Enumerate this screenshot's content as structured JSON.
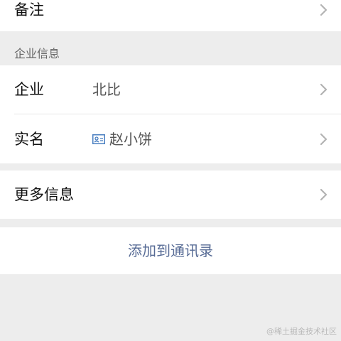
{
  "remark_row": {
    "label": "备注"
  },
  "enterprise_section": {
    "title": "企业信息"
  },
  "enterprise_row": {
    "label": "企业",
    "value": "北比"
  },
  "realname_row": {
    "label": "实名",
    "value": "赵小饼",
    "icon": "id-card-icon"
  },
  "more_info_row": {
    "label": "更多信息"
  },
  "add_contact": {
    "label": "添加到通讯录"
  },
  "watermark": {
    "text": "@稀土掘金技术社区"
  },
  "colors": {
    "accent": "#576b95",
    "background": "#ededed",
    "card": "#ffffff"
  }
}
